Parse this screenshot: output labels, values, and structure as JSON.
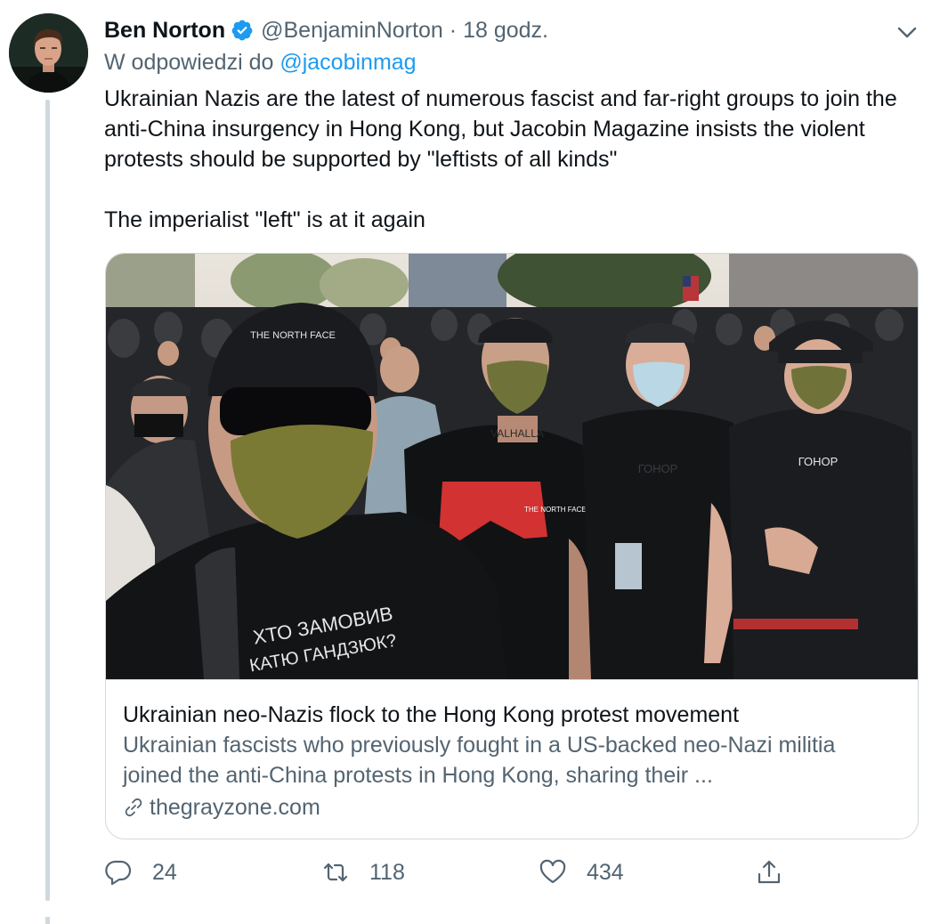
{
  "tweet": {
    "author_name": "Ben Norton",
    "author_handle": "@BenjaminNorton",
    "separator": "·",
    "time": "18 godz.",
    "reply_prefix": "W odpowiedzi do",
    "reply_to": "@jacobinmag",
    "paragraphs": [
      "Ukrainian Nazis are the latest of numerous fascist and far-right groups to join the anti-China insurgency in Hong Kong, but Jacobin Magazine insists the violent protests should be supported by \"leftists of all kinds\"",
      "The imperialist \"left\" is at it again"
    ]
  },
  "card": {
    "photo": {
      "cap_text": "THE NORTH FACE",
      "shirt_line1": "ХТО ЗАМОВИВ",
      "shirt_line2": "КАТЮ ГАНДЗЮК?",
      "neck_text": "VALHALLA",
      "chest_text": "ГОНОР"
    },
    "title": "Ukrainian neo-Nazis flock to the Hong Kong protest movement",
    "description": "Ukrainian fascists who previously fought in a US-backed neo-Nazi militia joined the anti-China protests in Hong Kong, sharing their ...",
    "domain": "thegrayzone.com"
  },
  "actions": {
    "reply_count": "24",
    "retweet_count": "118",
    "like_count": "434"
  },
  "colors": {
    "accent": "#1d9bf0",
    "text_primary": "#0f1419",
    "text_secondary": "#536471",
    "border": "#cfd9de"
  },
  "icons": [
    "verified-badge-icon",
    "chevron-down-icon",
    "link-icon",
    "reply-icon",
    "retweet-icon",
    "like-icon",
    "share-icon"
  ]
}
